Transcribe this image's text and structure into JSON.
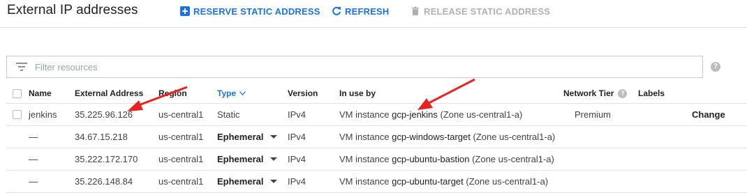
{
  "header": {
    "title": "External IP addresses",
    "reserve_label": "RESERVE STATIC ADDRESS",
    "refresh_label": "REFRESH",
    "release_label": "RELEASE STATIC ADDRESS"
  },
  "filter": {
    "placeholder": "Filter resources"
  },
  "columns": {
    "name": "Name",
    "address": "External Address",
    "region": "Region",
    "type": "Type",
    "version": "Version",
    "in_use_by": "In use by",
    "network_tier": "Network Tier",
    "labels": "Labels"
  },
  "rows": [
    {
      "name": "jenkins",
      "address": "35.225.96.126",
      "region": "us-central1",
      "type": "Static",
      "version": "IPv4",
      "vm_prefix": "VM instance ",
      "vm": "gcp-jenkins",
      "zone": " (Zone us-central1-a)",
      "tier": "Premium",
      "action": "Change"
    },
    {
      "name": "—",
      "address": "34.67.15.218",
      "region": "us-central1",
      "type": "Ephemeral",
      "version": "IPv4",
      "vm_prefix": "VM instance ",
      "vm": "gcp-windows-target",
      "zone": " (Zone us-central1-a)"
    },
    {
      "name": "—",
      "address": "35.222.172.170",
      "region": "us-central1",
      "type": "Ephemeral",
      "version": "IPv4",
      "vm_prefix": "VM instance ",
      "vm": "gcp-ubuntu-bastion",
      "zone": " (Zone us-central1-a)"
    },
    {
      "name": "—",
      "address": "35.226.148.84",
      "region": "us-central1",
      "type": "Ephemeral",
      "version": "IPv4",
      "vm_prefix": "VM instance ",
      "vm": "gcp-ubuntu-target",
      "zone": " (Zone us-central1-a)"
    }
  ],
  "colors": {
    "accent": "#1a73e8",
    "annotation_arrow": "#e8231f",
    "disabled": "#b0b0b0"
  }
}
